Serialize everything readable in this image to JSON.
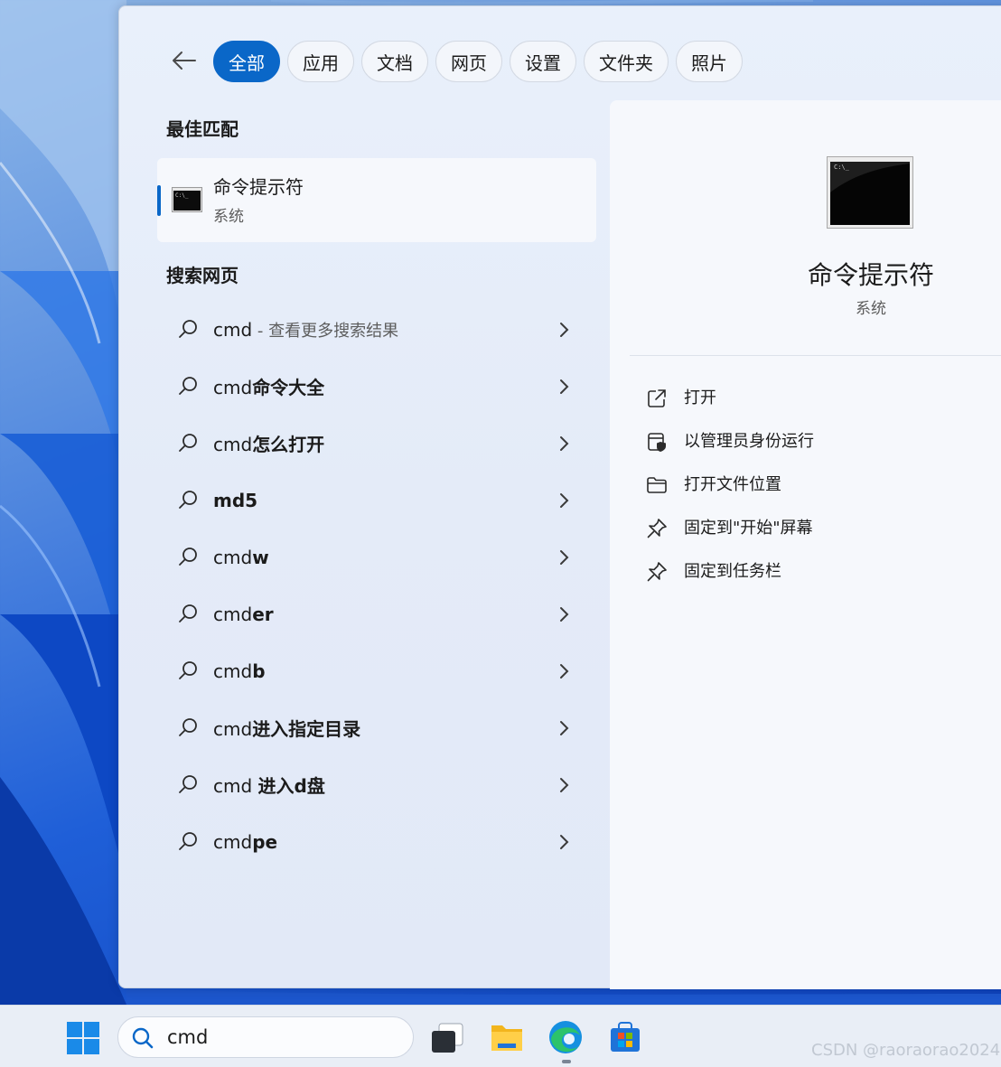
{
  "filter_tabs": [
    "全部",
    "应用",
    "文档",
    "网页",
    "设置",
    "文件夹",
    "照片"
  ],
  "best_match": {
    "section_title": "最佳匹配",
    "name": "命令提示符",
    "subtitle": "系统"
  },
  "web_search": {
    "section_title": "搜索网页",
    "items": [
      {
        "prefix": "cmd",
        "bold": "",
        "muted": " - 查看更多搜索结果"
      },
      {
        "prefix": "cmd",
        "bold": "命令大全",
        "muted": ""
      },
      {
        "prefix": "cmd",
        "bold": "怎么打开",
        "muted": ""
      },
      {
        "prefix": "",
        "bold": "md5",
        "muted": ""
      },
      {
        "prefix": "cmd",
        "bold": "w",
        "muted": ""
      },
      {
        "prefix": "cmd",
        "bold": "er",
        "muted": ""
      },
      {
        "prefix": "cmd",
        "bold": "b",
        "muted": ""
      },
      {
        "prefix": "cmd",
        "bold": "进入指定目录",
        "muted": ""
      },
      {
        "prefix": "cmd ",
        "bold": "进入d盘",
        "muted": ""
      },
      {
        "prefix": "cmd",
        "bold": "pe",
        "muted": ""
      }
    ]
  },
  "detail": {
    "title": "命令提示符",
    "subtitle": "系统",
    "actions": [
      {
        "label": "打开",
        "icon": "open-external-icon"
      },
      {
        "label": "以管理员身份运行",
        "icon": "admin-shield-icon"
      },
      {
        "label": "打开文件位置",
        "icon": "folder-icon"
      },
      {
        "label": "固定到\"开始\"屏幕",
        "icon": "pin-icon"
      },
      {
        "label": "固定到任务栏",
        "icon": "pin-icon"
      }
    ]
  },
  "taskbar": {
    "search_value": "cmd",
    "apps": [
      "windows-start-icon",
      "task-view-icon",
      "file-explorer-icon",
      "edge-icon",
      "microsoft-store-icon"
    ]
  },
  "watermark": "CSDN @raoraorao2024",
  "colors": {
    "accent": "#0a67c8",
    "panel": "#e6edf9",
    "detail": "#f6f8fc"
  }
}
